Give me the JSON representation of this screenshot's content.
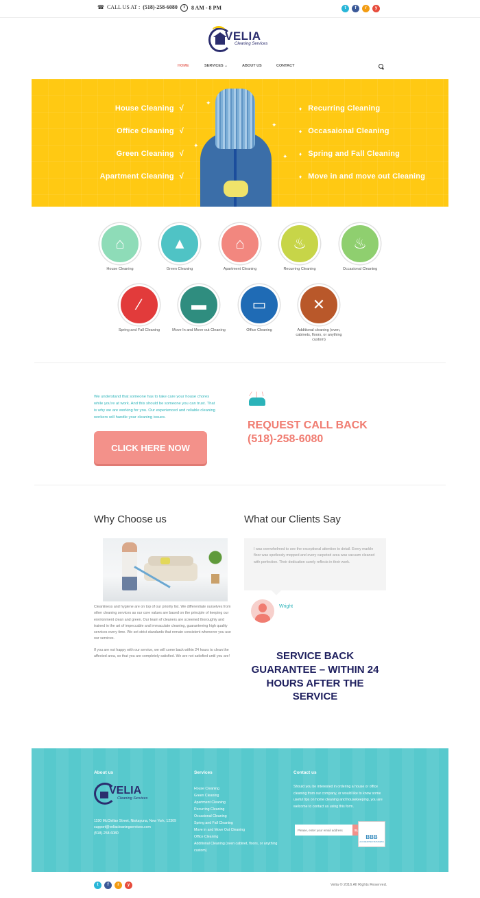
{
  "topbar": {
    "call_prefix": "CALL US AT :",
    "phone": "(518)-258-6080",
    "hours": "8 AM - 8 PM",
    "socials": [
      {
        "icon": "twitter-icon",
        "glyph": "t",
        "color": "#29b6d8"
      },
      {
        "icon": "facebook-icon",
        "glyph": "f",
        "color": "#3b5998"
      },
      {
        "icon": "rss-icon",
        "glyph": "r",
        "color": "#f39c12"
      },
      {
        "icon": "youtube-icon",
        "glyph": "y",
        "color": "#e74c3c"
      }
    ]
  },
  "logo": {
    "name": "VELIA",
    "tagline": "Cleaning Services"
  },
  "nav": {
    "home": "HOME",
    "services": "SERVICES",
    "services_caret": "⌄",
    "about": "ABOUT US",
    "contact": "CONTACT"
  },
  "hero": {
    "left_items": [
      "House Cleaning",
      "Office Cleaning",
      "Green Cleaning",
      "Apartment Cleaning"
    ],
    "right_items": [
      "Recurring Cleaning",
      "Occasaional Cleaning",
      "Spring and Fall Cleaning",
      "Move in and move out Cleaning"
    ],
    "check": "√",
    "bullet": "♦",
    "bg_color": "#ffc913"
  },
  "services": [
    {
      "label": "House Cleaning",
      "color": "#8edcb8",
      "glyph": "⌂",
      "icon": "house-icon"
    },
    {
      "label": "Green Cleaning",
      "color": "#4fc3c5",
      "glyph": "▲",
      "icon": "tree-icon"
    },
    {
      "label": "Apartment Cleaning",
      "color": "#f2877f",
      "glyph": "⌂",
      "icon": "apartment-icon"
    },
    {
      "label": "Recurring Cleaning",
      "color": "#c7d548",
      "glyph": "♨",
      "icon": "vacuum-icon"
    },
    {
      "label": "Occasional Cleaning",
      "color": "#8fcf6f",
      "glyph": "♨",
      "icon": "bowl-icon"
    },
    {
      "label": "Spring and Fall Cleaning",
      "color": "#e23b3b",
      "glyph": "⁄",
      "icon": "broom-icon"
    },
    {
      "label": "Move In and Move out Cleaning",
      "color": "#2f8d7f",
      "glyph": "▬",
      "icon": "truck-icon"
    },
    {
      "label": "Office Cleaning",
      "color": "#1f6bb5",
      "glyph": "▭",
      "icon": "monitor-icon"
    },
    {
      "label": "Additional cleaning (oven, cabinets, floors, or anything custom)",
      "color": "#b9582a",
      "glyph": "✕",
      "icon": "tools-icon"
    }
  ],
  "callback": {
    "text": "We understand that someone has to take care your house chores while you're at work. And this should be someone you can trust. That is why we are working for you. Our experienced and reliable cleaning workers will handle your cleaning issues.",
    "button": "CLICK HERE NOW",
    "rays": "⁄ | \\",
    "title": "REQUEST CALL BACK",
    "phone": "(518)-258-6080"
  },
  "why": {
    "title": "Why Choose us",
    "p1": "Cleanliness and hygiene are on top of our priority list. We differentiate ourselves from other cleaning services as our core values are based on the principle of keeping our environment clean and green. Our team of cleaners are screened thoroughly and trained in the art of impeccable and immaculate cleaning, guaranteeing high quality services every time. We set strict standards that remain consistent whenever you use our services.",
    "p2": "If you are not happy with our service, we will come back within 24 hours to clean the affected area, so that you are completely satisfied. We are not satisfied until you are!"
  },
  "clients": {
    "title": "What our Clients Say",
    "quote": "I was overwhelmed to see the exceptional attention to detail. Every marble floor was spotlessly mopped and every carpeted area was vacuum cleaned with perfection. Their dedication surely reflects in their work.",
    "name": "Wright"
  },
  "guarantee": "SERVICE BACK GUARANTEE – WITHIN 24 HOURS AFTER THE SERVICE",
  "footer": {
    "about_title": "About us",
    "address": "1190 McClellan Street, Niskayuna, New York, 12309",
    "email": "support@veliacleaningservices.com",
    "phone": "(518)-258-6080",
    "services_title": "Services",
    "services": [
      "House Cleaning",
      "Green Cleaning",
      "Apartment Cleaning",
      "Recurring Cleaning",
      "Occasional Cleaning",
      "Spring and Fall Cleaning",
      "Move in and Move Out Cleaning",
      "Office Cleaning",
      "Additional Cleaning (oven cabinet, floors, or anything custom)"
    ],
    "contact_title": "Contact us",
    "contact_text": "Should you be interested in ordering a house or office cleaning from our company, or would like to know some useful tips on home cleaning and housekeeping, you are welcome to contact us using this form.",
    "email_placeholder": "Please, enter your email address",
    "subscribe": "SUBSCRIBE",
    "bbb": "BBB",
    "bbb_sub": "ACCREDITED BUSINESS",
    "bg_color": "#57c9cd"
  },
  "copyright": "Velia © 2016 All Rights Reserved."
}
